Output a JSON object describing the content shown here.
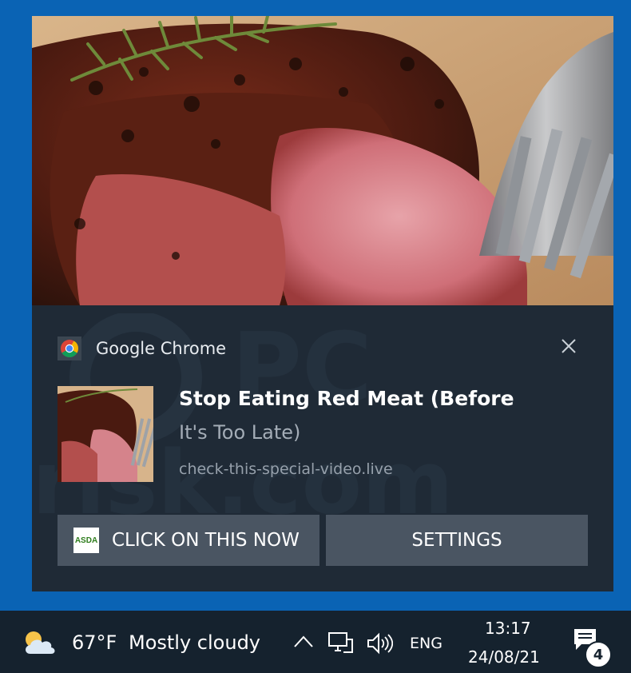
{
  "notification": {
    "app_name": "Google Chrome",
    "title": "Stop Eating Red Meat (Before",
    "subtitle": "It's Too Late)",
    "url": "check-this-special-video.live",
    "hero_icon": "steak-image",
    "close_icon": "close-icon",
    "actions": {
      "primary_label": "CLICK ON THIS NOW",
      "primary_icon_text": "ASDA",
      "settings_label": "SETTINGS"
    },
    "watermark_text": "PC risk.com"
  },
  "taskbar": {
    "weather_icon": "partly-cloudy-icon",
    "temperature": "67°F",
    "weather": "Mostly cloudy",
    "language": "ENG",
    "time": "13:17",
    "date": "24/08/21",
    "notification_count": "4"
  },
  "colors": {
    "desktop": "#0a63b4",
    "toast_bg": "#1f2a36",
    "button_bg": "#4a5562",
    "taskbar_bg": "#15222e"
  }
}
